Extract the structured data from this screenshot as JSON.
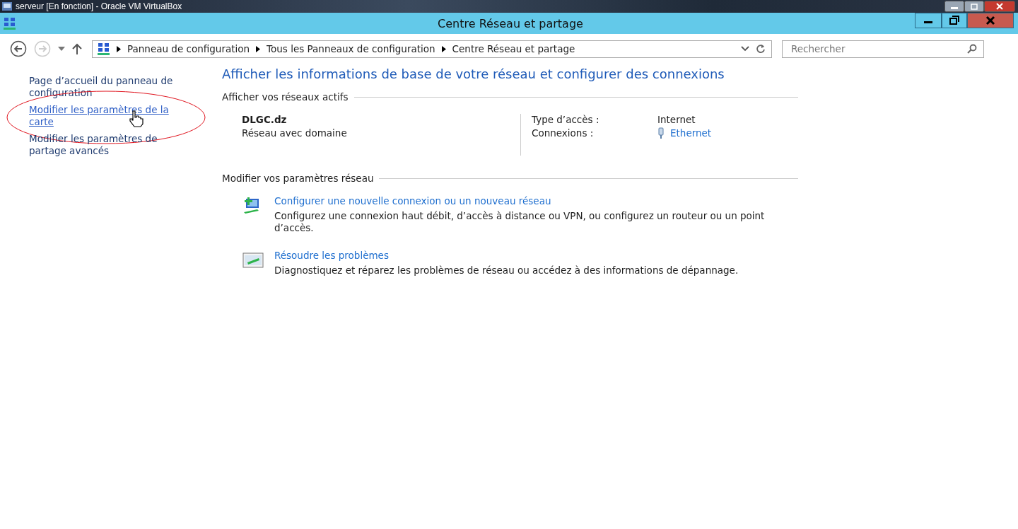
{
  "host_window": {
    "title": "serveur [En fonction] - Oracle VM VirtualBox"
  },
  "window": {
    "title": "Centre Réseau et partage"
  },
  "navigation": {
    "back_enabled": true,
    "forward_enabled": false
  },
  "breadcrumb": [
    "Panneau de configuration",
    "Tous les Panneaux de configuration",
    "Centre Réseau et partage"
  ],
  "search": {
    "placeholder": "Rechercher"
  },
  "sidebar": {
    "items": [
      {
        "label": "Page d’accueil du panneau de configuration",
        "hovered": false,
        "circled": false
      },
      {
        "label": "Modifier les paramètres de la carte",
        "hovered": true,
        "circled": true
      },
      {
        "label": "Modifier les paramètres de partage avancés",
        "hovered": false,
        "circled": false
      }
    ]
  },
  "heading": "Afficher les informations de base de votre réseau et configurer des connexions",
  "active_networks": {
    "title": "Afficher vos réseaux actifs",
    "name": "DLGC.dz",
    "category": "Réseau avec domaine",
    "access_label": "Type d’accès :",
    "access_value": "Internet",
    "connections_label": "Connexions :",
    "connections_value": "Ethernet"
  },
  "change_settings": {
    "title": "Modifier vos paramètres réseau",
    "tasks": [
      {
        "kind": "new-connection",
        "link": "Configurer une nouvelle connexion ou un nouveau réseau",
        "description": "Configurez une connexion haut débit, d’accès à distance ou VPN, ou configurez un routeur ou un point d’accès."
      },
      {
        "kind": "troubleshoot",
        "link": "Résoudre les problèmes",
        "description": "Diagnostiquez et réparez les problèmes de réseau ou accédez à des informations de dépannage."
      }
    ]
  }
}
